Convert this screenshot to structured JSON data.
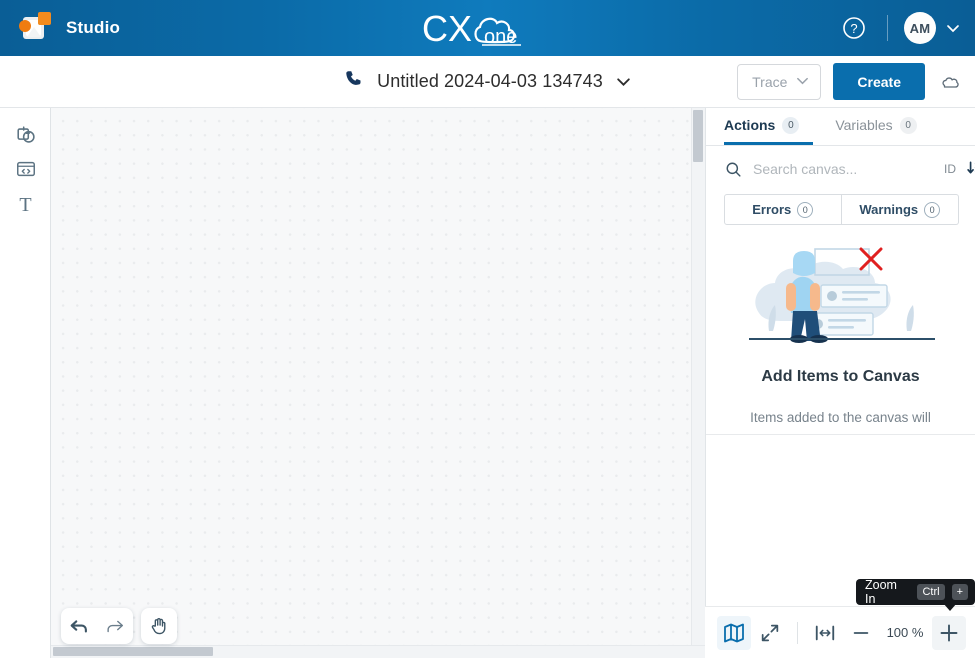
{
  "header": {
    "brand": "Studio",
    "app_icon": "studio-app-icon",
    "logo_primary": "CX",
    "logo_secondary": "one",
    "help_icon": "help-circle-icon",
    "avatar_initials": "AM",
    "avatar_caret_icon": "chevron-down-icon"
  },
  "toolbar": {
    "phone_icon": "phone-icon",
    "script_name": "Untitled 2024-04-03 134743",
    "title_caret_icon": "chevron-down-icon",
    "trace_label": "Trace",
    "trace_caret_icon": "chevron-down-icon",
    "create_label": "Create",
    "cloud_icon": "cloud-icon",
    "accent_color": "#0a6ead"
  },
  "rail": {
    "items": [
      {
        "name": "shapes-icon",
        "label": "Shapes"
      },
      {
        "name": "snippet-icon",
        "label": "Snippet"
      },
      {
        "name": "text-icon",
        "label": "T"
      }
    ]
  },
  "canvas": {
    "background": "#f7f8f9",
    "dot_color": "#e9ebed",
    "tools": [
      {
        "name": "undo-icon",
        "label": "Undo"
      },
      {
        "name": "redo-icon",
        "label": "Redo"
      },
      {
        "name": "pan-hand-icon",
        "label": "Pan"
      }
    ]
  },
  "panel": {
    "tabs": [
      {
        "label": "Actions",
        "count": "0",
        "active": true
      },
      {
        "label": "Variables",
        "count": "0",
        "active": false
      }
    ],
    "search": {
      "icon": "search-icon",
      "placeholder": "Search canvas...",
      "value": "",
      "sort_label": "ID",
      "sort_icon": "sort-descending-icon"
    },
    "filters": [
      {
        "label": "Errors",
        "count": "0"
      },
      {
        "label": "Warnings",
        "count": "0"
      }
    ],
    "empty_state": {
      "illustration": "person-empty-list-illustration",
      "title": "Add Items to Canvas",
      "description": "Items added to the canvas will"
    }
  },
  "zoombar": {
    "buttons": [
      {
        "name": "minimap-icon",
        "label": "Minimap",
        "active": true
      },
      {
        "name": "fit-screen-icon",
        "label": "Fit to screen",
        "active": false
      },
      {
        "name": "fit-width-icon",
        "label": "Fit to width",
        "active": false
      },
      {
        "name": "zoom-out-icon",
        "label": "Zoom Out",
        "active": false
      }
    ],
    "zoom_level": "100 %",
    "zoom_in_icon": "zoom-in-icon"
  },
  "tooltip": {
    "text": "Zoom In",
    "key_modifier": "Ctrl",
    "key_main": "+"
  }
}
